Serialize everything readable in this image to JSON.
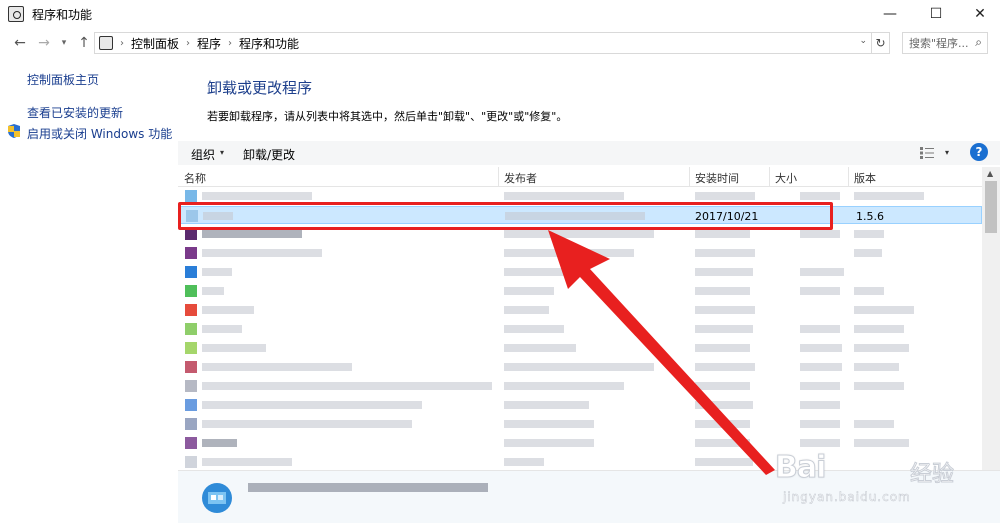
{
  "window": {
    "title": "程序和功能",
    "minimize": "—",
    "maximize": "☐",
    "close": "✕"
  },
  "address": {
    "back": "←",
    "forward": "→",
    "history": "▾",
    "up": "↑",
    "breadcrumbs": [
      "控制面板",
      "程序",
      "程序和功能"
    ],
    "separator": "›",
    "dropdown": "⌄",
    "refresh": "↻",
    "search_placeholder": "搜索\"程序...",
    "search_glyph": "⌕"
  },
  "sidebar": {
    "items": [
      {
        "label": "控制面板主页"
      },
      {
        "label": "查看已安装的更新"
      },
      {
        "label": "启用或关闭 Windows 功能"
      }
    ]
  },
  "main": {
    "title": "卸载或更改程序",
    "description": "若要卸载程序，请从列表中将其选中，然后单击\"卸载\"、\"更改\"或\"修复\"。"
  },
  "toolbar": {
    "organize": "组织",
    "caret": "▾",
    "uninstall_change": "卸载/更改",
    "help": "?"
  },
  "columns": {
    "name": "名称",
    "publisher": "发布者",
    "install_date": "安装时间",
    "size": "大小",
    "version": "版本"
  },
  "selected_row": {
    "install_date": "2017/10/21",
    "version": "1.5.6"
  },
  "scrollbar": {
    "up": "▲"
  },
  "watermark": {
    "logo": "Bai",
    "text": "经验",
    "url": "jingyan.baidu.com"
  },
  "colors": {
    "highlight": "#e8201f",
    "selection": "#cce8ff",
    "link": "#1a3e8f"
  }
}
